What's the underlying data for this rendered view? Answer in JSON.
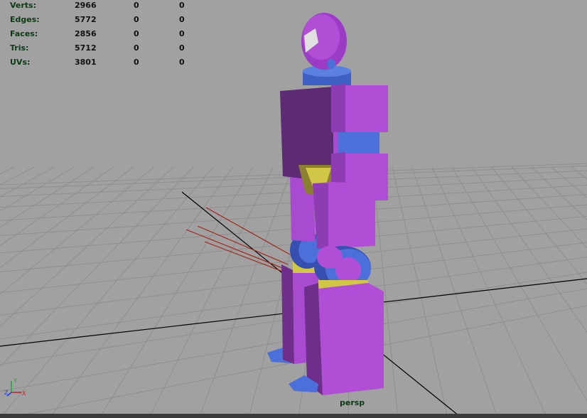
{
  "hud": {
    "rows": [
      {
        "label": "Verts:",
        "v1": "2966",
        "v2": "0",
        "v3": "0"
      },
      {
        "label": "Edges:",
        "v1": "5772",
        "v2": "0",
        "v3": "0"
      },
      {
        "label": "Faces:",
        "v1": "2856",
        "v2": "0",
        "v3": "0"
      },
      {
        "label": "Tris:",
        "v1": "5712",
        "v2": "0",
        "v3": "0"
      },
      {
        "label": "UVs:",
        "v1": "3801",
        "v2": "0",
        "v3": "0"
      }
    ]
  },
  "camera": {
    "name": "persp"
  },
  "axis": {
    "y": "Y",
    "z": "Z",
    "x": "X"
  },
  "colors": {
    "background": "#a1a1a1",
    "grid": "#8c8c8c",
    "purple": "#b04ed6",
    "blue": "#4b70d9",
    "yellow": "#d2c646",
    "hud_label": "#0b3a14"
  }
}
